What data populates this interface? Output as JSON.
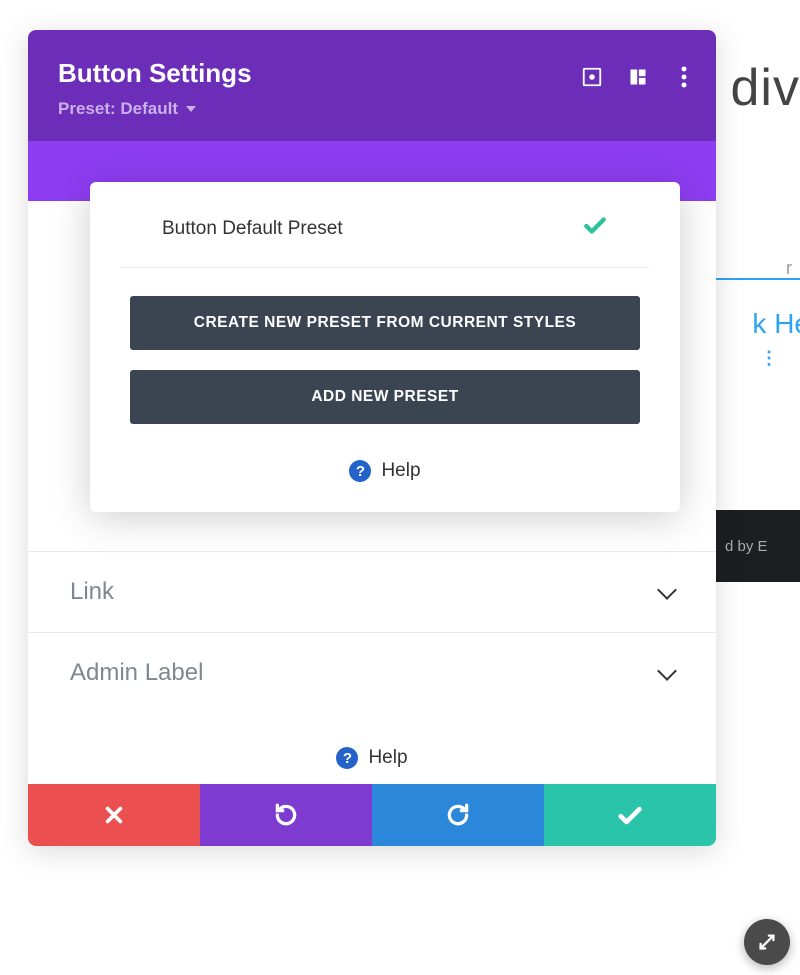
{
  "background": {
    "right_text": "div",
    "blue_text": "k He",
    "r_partial": "r",
    "dark_bar_text": "d by E"
  },
  "header": {
    "title": "Button Settings",
    "preset_prefix": "Preset:",
    "preset_value": "Default"
  },
  "preset_popover": {
    "selected_item": "Button Default Preset",
    "create_button": "CREATE NEW PRESET FROM CURRENT STYLES",
    "add_button": "ADD NEW PRESET",
    "help": "Help"
  },
  "accordions": [
    {
      "label": "Link"
    },
    {
      "label": "Admin Label"
    }
  ],
  "footer": {
    "help": "Help"
  }
}
